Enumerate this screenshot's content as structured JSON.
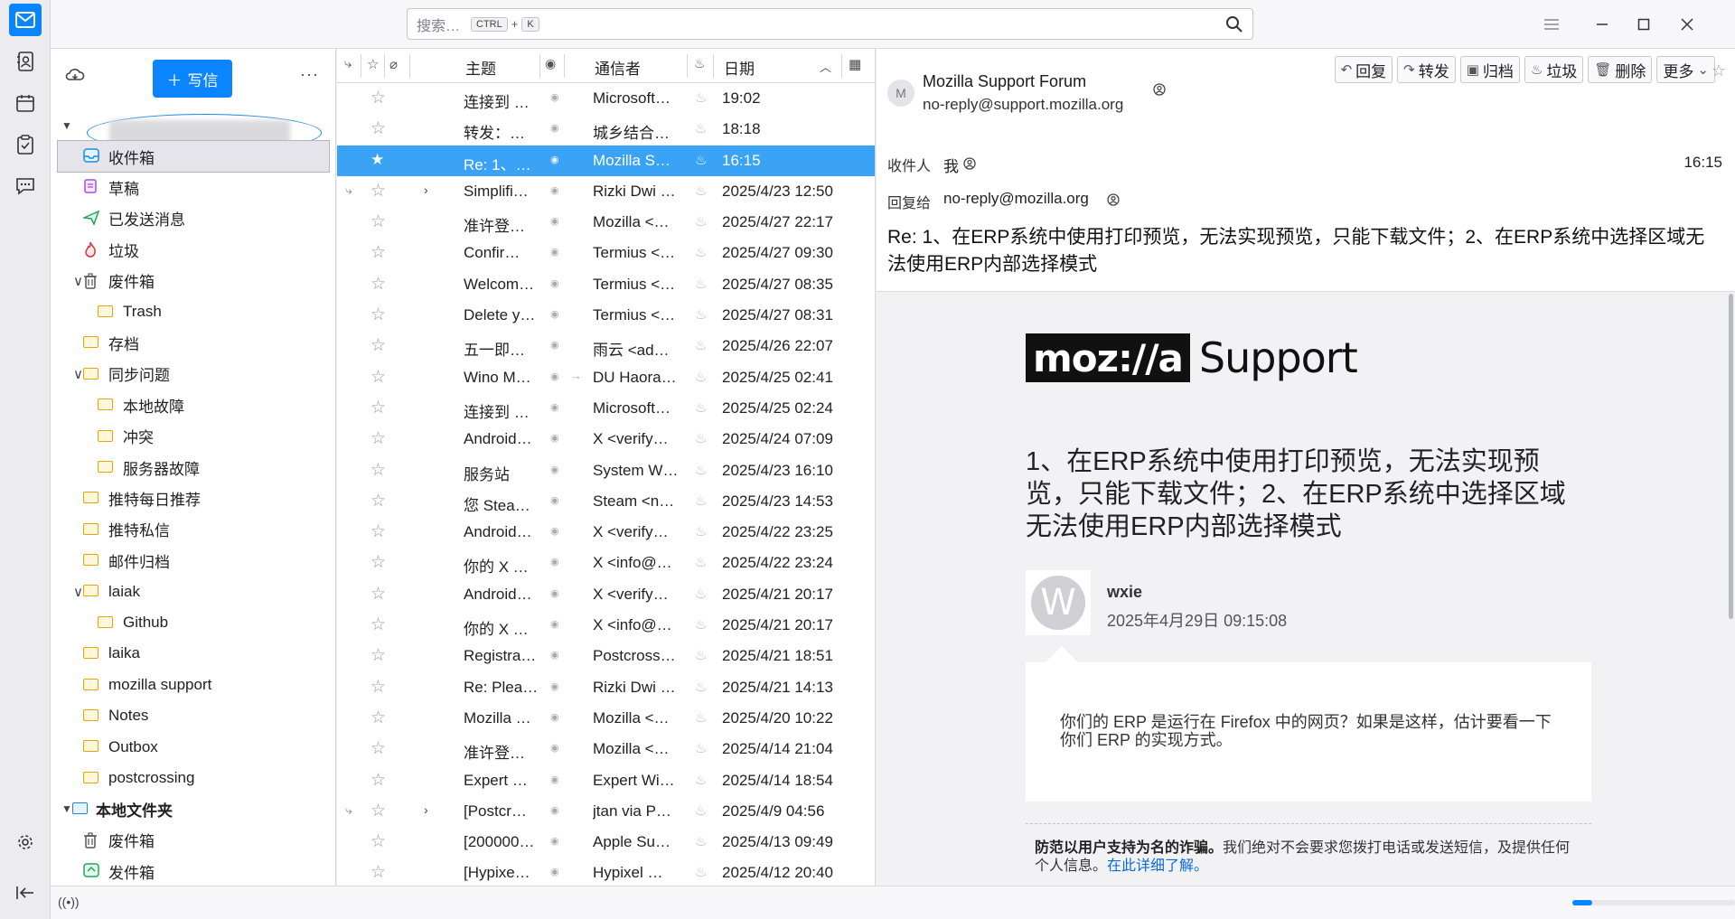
{
  "search": {
    "placeholder": "搜索…",
    "kbd1": "CTRL",
    "plus": "+",
    "kbd2": "K"
  },
  "folderpane": {
    "write_label": "写信",
    "folders": [
      {
        "label": "收件箱",
        "icon": "inbox-icon",
        "level": 1,
        "selected": true
      },
      {
        "label": "草稿",
        "icon": "drafts-icon",
        "level": 1
      },
      {
        "label": "已发送消息",
        "icon": "sent-icon",
        "level": 1
      },
      {
        "label": "垃圾",
        "icon": "junk-icon",
        "level": 1
      },
      {
        "label": "废件箱",
        "icon": "trash-icon",
        "level": 1,
        "expanded": true
      },
      {
        "label": "Trash",
        "icon": "folder-icon",
        "level": 2
      },
      {
        "label": "存档",
        "icon": "folder-icon",
        "level": 1
      },
      {
        "label": "同步问题",
        "icon": "folder-icon",
        "level": 1,
        "expanded": true
      },
      {
        "label": "本地故障",
        "icon": "folder-icon",
        "level": 2
      },
      {
        "label": "冲突",
        "icon": "folder-icon",
        "level": 2
      },
      {
        "label": "服务器故障",
        "icon": "folder-icon",
        "level": 2
      },
      {
        "label": "推特每日推荐",
        "icon": "folder-icon",
        "level": 1
      },
      {
        "label": "推特私信",
        "icon": "folder-icon",
        "level": 1
      },
      {
        "label": "邮件归档",
        "icon": "folder-icon",
        "level": 1
      },
      {
        "label": "laiak",
        "icon": "folder-icon",
        "level": 1,
        "expanded": true
      },
      {
        "label": "Github",
        "icon": "folder-icon",
        "level": 2
      },
      {
        "label": "laika",
        "icon": "folder-icon",
        "level": 1
      },
      {
        "label": "mozilla support",
        "icon": "folder-icon",
        "level": 1
      },
      {
        "label": "Notes",
        "icon": "folder-icon",
        "level": 1
      },
      {
        "label": "Outbox",
        "icon": "folder-icon",
        "level": 1
      },
      {
        "label": "postcrossing",
        "icon": "folder-icon",
        "level": 1
      }
    ],
    "local_account": "本地文件夹",
    "local_folders": [
      {
        "label": "废件箱",
        "icon": "trash-icon"
      },
      {
        "label": "发件箱",
        "icon": "outbox-icon"
      }
    ]
  },
  "msglist": {
    "headers": {
      "subject": "主题",
      "correspondent": "通信者",
      "date": "日期"
    },
    "rows": [
      {
        "subject": "连接到 …",
        "corr": "Microsoft…",
        "date": "19:02"
      },
      {
        "subject": "转发：…",
        "corr": "城乡结合…",
        "date": "18:18"
      },
      {
        "subject": "Re: 1、…",
        "corr": "Mozilla S…",
        "date": "16:15",
        "selected": true
      },
      {
        "subject": "Simplifi…",
        "corr": "Rizki Dwi …",
        "date": "2025/4/23 12:50",
        "thread": true
      },
      {
        "subject": "准许登…",
        "corr": "Mozilla <…",
        "date": "2025/4/27 22:17"
      },
      {
        "subject": "Confir…",
        "corr": "Termius <…",
        "date": "2025/4/27 09:30"
      },
      {
        "subject": "Welcom…",
        "corr": "Termius <…",
        "date": "2025/4/27 08:35"
      },
      {
        "subject": "Delete y…",
        "corr": "Termius <…",
        "date": "2025/4/27 08:31"
      },
      {
        "subject": "五一即…",
        "corr": "雨云 <ad…",
        "date": "2025/4/26 22:07"
      },
      {
        "subject": "Wino M…",
        "corr": "DU Haora…",
        "date": "2025/4/25 02:41",
        "forwarded": true
      },
      {
        "subject": "连接到 …",
        "corr": "Microsoft…",
        "date": "2025/4/25 02:24"
      },
      {
        "subject": "Android…",
        "corr": "X <verify…",
        "date": "2025/4/24 07:09"
      },
      {
        "subject": "服务站",
        "corr": "System W…",
        "date": "2025/4/23 16:10"
      },
      {
        "subject": "您 Stea…",
        "corr": "Steam <n…",
        "date": "2025/4/23 14:53"
      },
      {
        "subject": "Android…",
        "corr": "X <verify…",
        "date": "2025/4/22 23:25"
      },
      {
        "subject": "你的 X …",
        "corr": "X <info@…",
        "date": "2025/4/22 23:24"
      },
      {
        "subject": "Android…",
        "corr": "X <verify…",
        "date": "2025/4/21 20:17"
      },
      {
        "subject": "你的 X …",
        "corr": "X <info@…",
        "date": "2025/4/21 20:17"
      },
      {
        "subject": "Registra…",
        "corr": "Postcross…",
        "date": "2025/4/21 18:51"
      },
      {
        "subject": "Re: Plea…",
        "corr": "Rizki Dwi …",
        "date": "2025/4/21 14:13"
      },
      {
        "subject": "Mozilla …",
        "corr": "Mozilla <…",
        "date": "2025/4/20 10:22"
      },
      {
        "subject": "准许登…",
        "corr": "Mozilla <…",
        "date": "2025/4/14 21:04"
      },
      {
        "subject": "Expert …",
        "corr": "Expert Wi…",
        "date": "2025/4/14 18:54"
      },
      {
        "subject": "[Postcr…",
        "corr": "jtan via P…",
        "date": "2025/4/9 04:56",
        "thread": true
      },
      {
        "subject": "[200000…",
        "corr": "Apple Su…",
        "date": "2025/4/13 09:49"
      },
      {
        "subject": "[Hypixe…",
        "corr": "Hypixel …",
        "date": "2025/4/12 20:40"
      }
    ]
  },
  "reader": {
    "actions": {
      "reply": "回复",
      "forward": "转发",
      "archive": "归档",
      "junk": "垃圾",
      "delete": "删除",
      "more": "更多"
    },
    "avatar_letter": "M",
    "from_name": "Mozilla Support Forum",
    "from_addr": "no-reply@support.mozilla.org",
    "to_label": "收件人",
    "to_value": "我",
    "time": "16:15",
    "replyto_label": "回复给",
    "replyto_value": "no-reply@mozilla.org",
    "subject": "Re: 1、在ERP系统中使用打印预览，无法实现预览，只能下载文件；2、在ERP系统中选择区域无法使用ERP内部选择模式",
    "body": {
      "logo_text": "moz://a",
      "logo_support": "Support",
      "question_title": "1、在ERP系统中使用打印预览，无法实现预览，只能下载文件；2、在ERP系统中选择区域无法使用ERP内部选择模式",
      "author_initial": "W",
      "author_name": "wxie",
      "author_date": "2025年4月29日 09:15:08",
      "reply_text": "你们的 ERP 是运行在 Firefox 中的网页？如果是这样，估计要看一下你们 ERP 的实现方式。",
      "warn_bold": "防范以用户支持为名的诈骗。",
      "warn_text": "我们绝对不会要求您拨打电话或发送短信，及提供任何个人信息。",
      "warn_link": "在此详细了解。"
    }
  },
  "status": {
    "progress": 0.12
  }
}
